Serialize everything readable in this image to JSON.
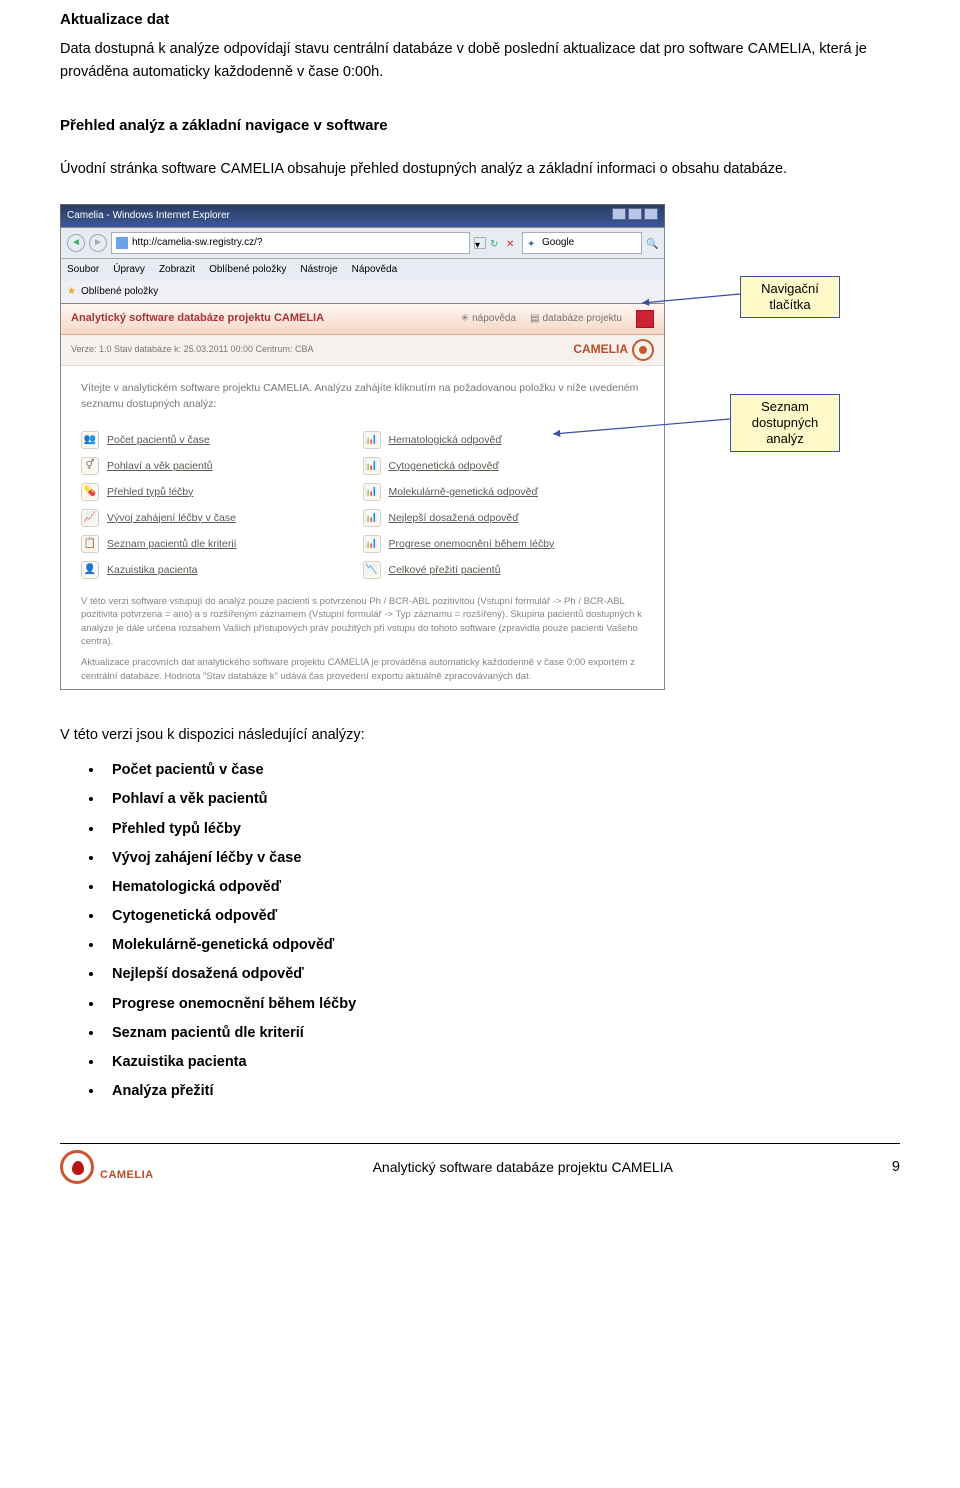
{
  "doc": {
    "section_title": "Aktualizace dat",
    "section_para": "Data dostupná k analýze odpovídají stavu centrální databáze v době poslední aktualizace dat pro software CAMELIA, která je prováděna automaticky každodenně v čase 0:00h.",
    "nav_title": "Přehled analýz a základní navigace v software",
    "nav_para": "Úvodní stránka software CAMELIA obsahuje přehled dostupných analýz a základní informaci o obsahu databáze.",
    "list_intro": "V této verzi jsou k dispozici následující analýzy:",
    "bullets": [
      "Počet pacientů v čase",
      "Pohlaví a věk pacientů",
      "Přehled typů léčby",
      "Vývoj zahájení léčby v čase",
      "Hematologická odpověď",
      "Cytogenetická odpověď",
      "Molekulárně-genetická odpověď",
      "Nejlepší dosažená odpověď",
      "Progrese onemocnění během léčby",
      "Seznam pacientů dle kriterií",
      "Kazuistika pacienta",
      "Analýza přežití"
    ]
  },
  "browser": {
    "title": "Camelia - Windows Internet Explorer",
    "url": "http://camelia-sw.registry.cz/?",
    "search_engine": "Google",
    "menu": [
      "Soubor",
      "Úpravy",
      "Zobrazit",
      "Oblíbené položky",
      "Nástroje",
      "Nápověda"
    ],
    "fav": "Oblíbené položky"
  },
  "app": {
    "header_title": "Analytický software databáze projektu CAMELIA",
    "link_help": "nápověda",
    "link_db": "databáze projektu",
    "version_line": "Verze: 1.0   Stav databáze k: 25.03.2011 00:00   Centrum: CBA",
    "logo_text": "CAMELIA",
    "intro": "Vítejte v analytickém software projektu CAMELIA. Analýzu zahájíte kliknutím na požadovanou položku v níže uvedeném seznamu dostupných analýz:",
    "left_items": [
      "Počet pacientů v čase",
      "Pohlaví a věk pacientů",
      "Přehled typů léčby",
      "Vývoj zahájení léčby v čase",
      "Seznam pacientů dle kriterií",
      "Kazuistika pacienta"
    ],
    "right_items": [
      "Hematologická odpověď",
      "Cytogenetická odpověď",
      "Molekulárně-genetická odpověď",
      "Nejlepší dosažená odpověď",
      "Progrese onemocnění během léčby",
      "Celkové přežití pacientů"
    ],
    "note1": "V této verzi software vstupují do analýz pouze pacienti s potvrzenou Ph / BCR-ABL pozitivitou (Vstupní formulář -> Ph / BCR-ABL pozitivita potvrzena = ano) a s rozšířeným záznamem (Vstupní formulář -> Typ záznamu = rozšířený). Skupina pacientů dostupných k analýze je dále určena rozsahem Vašich přístupových práv použitých při vstupu do tohoto software (zpravidla pouze pacienti Vašeho centra).",
    "note2": "Aktualizace pracovních dat analytického software projektu CAMELIA je prováděna automaticky každodenně v čase 0:00 exportem z centrální databáze. Hodnota \"Stav databáze k\" udává čas provedení exportu aktuálně zpracovávaných dat."
  },
  "callouts": {
    "nav": "Navigační\ntlačítka",
    "list": "Seznam\ndostupných\nanalýz"
  },
  "footer": {
    "logo": "CAMELIA",
    "title": "Analytický software databáze projektu CAMELIA",
    "page": "9"
  }
}
